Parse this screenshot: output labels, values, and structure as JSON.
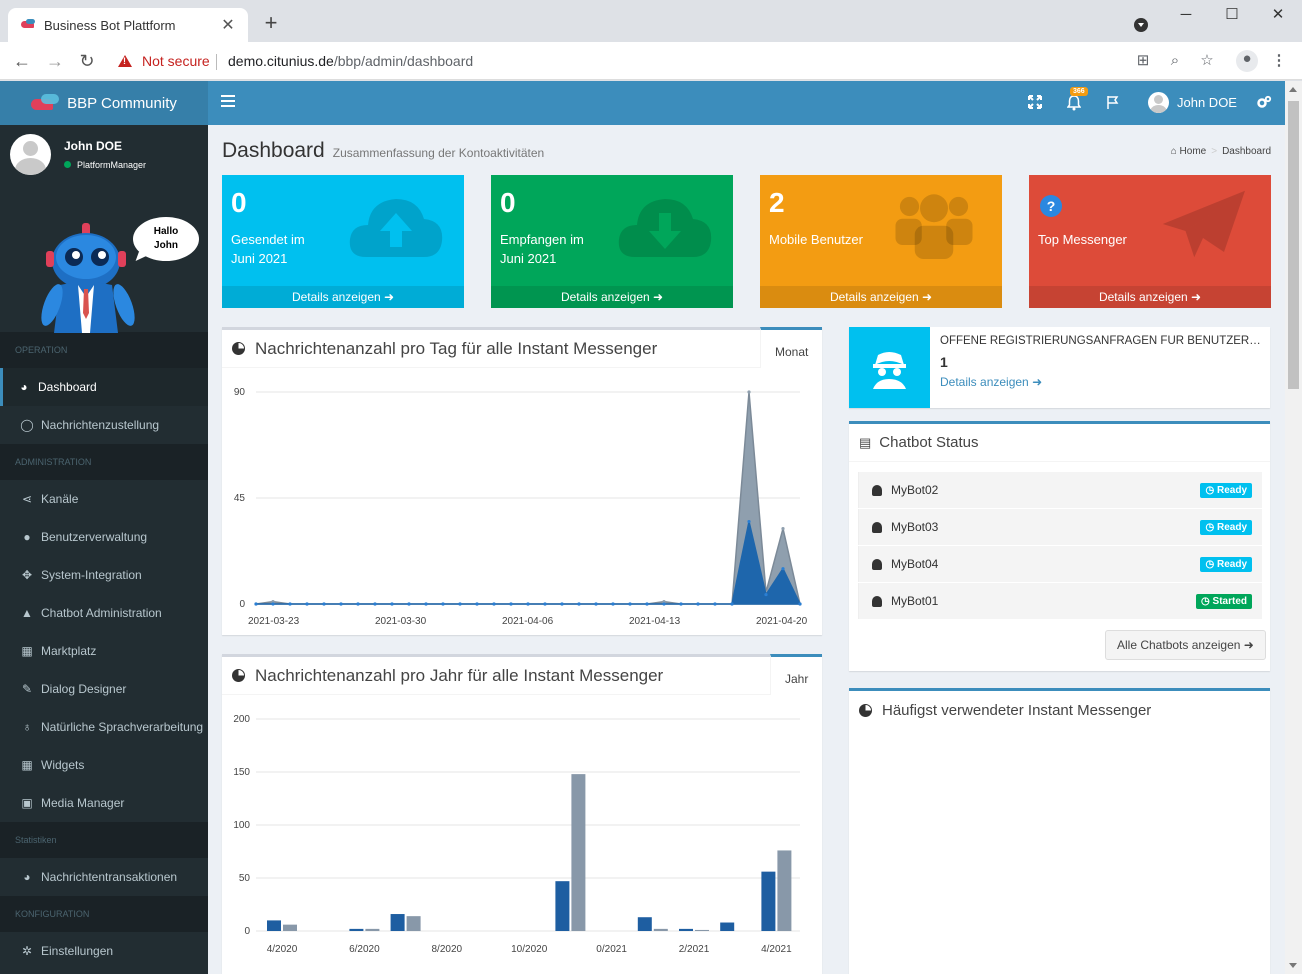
{
  "browser": {
    "tab_title": "Business Bot Plattform",
    "not_secure": "Not secure",
    "url_host": "demo.citunius.de",
    "url_path": "/bbp/admin/dashboard"
  },
  "header": {
    "logo": "BBP Community",
    "notification_count": "366",
    "user_name": "John DOE"
  },
  "sidebar": {
    "user_name": "John DOE",
    "user_role": "PlatformManager",
    "greeting_line1": "Hallo",
    "greeting_line2": "John",
    "sections": {
      "operation": "OPERATION",
      "administration": "ADMINISTRATION",
      "statistiken": "Statistiken",
      "konfiguration": "KONFIGURATION"
    },
    "items": {
      "dashboard": "Dashboard",
      "nachrichtenzustellung": "Nachrichtenzustellung",
      "kanaele": "Kanäle",
      "benutzerverwaltung": "Benutzerverwaltung",
      "system_integration": "System-Integration",
      "chatbot_admin": "Chatbot Administration",
      "marktplatz": "Marktplatz",
      "dialog_designer": "Dialog Designer",
      "nlp": "Natürliche Sprachverarbeitung",
      "widgets": "Widgets",
      "media_manager": "Media Manager",
      "nachrichtentransaktionen": "Nachrichtentransaktionen",
      "einstellungen": "Einstellungen"
    }
  },
  "page": {
    "title": "Dashboard",
    "subtitle": "Zusammenfassung der Kontoaktivitäten",
    "breadcrumb_home": "Home",
    "breadcrumb_current": "Dashboard"
  },
  "stats": [
    {
      "value": "0",
      "label_line1": "Gesendet im",
      "label_line2": "Juni 2021",
      "link": "Details anzeigen",
      "color": "#00c0ef"
    },
    {
      "value": "0",
      "label_line1": "Empfangen im",
      "label_line2": "Juni 2021",
      "link": "Details anzeigen",
      "color": "#00a65a"
    },
    {
      "value": "2",
      "label_line1": "Mobile Benutzer",
      "label_line2": "",
      "link": "Details anzeigen",
      "color": "#f39c12"
    },
    {
      "value": "",
      "label_line1": "Top Messenger",
      "label_line2": "",
      "link": "Details anzeigen",
      "color": "#dd4b39"
    }
  ],
  "daily_chart": {
    "title": "Nachrichtenanzahl pro Tag für alle Instant Messenger",
    "tab": "Monat"
  },
  "yearly_chart": {
    "title": "Nachrichtenanzahl pro Jahr für alle Instant Messenger",
    "tab": "Jahr"
  },
  "registration": {
    "title": "OFFENE REGISTRIERUNGSANFRAGEN FÜR BENUTZERKONTEN",
    "count": "1",
    "link": "Details anzeigen"
  },
  "chatbot_status": {
    "title": "Chatbot Status",
    "bots": [
      {
        "name": "MyBot02",
        "status": "Ready"
      },
      {
        "name": "MyBot03",
        "status": "Ready"
      },
      {
        "name": "MyBot04",
        "status": "Ready"
      },
      {
        "name": "MyBot01",
        "status": "Started"
      }
    ],
    "show_all": "Alle Chatbots anzeigen"
  },
  "messenger_box": {
    "title": "Häufigst verwendeter Instant Messenger"
  },
  "chart_data": [
    {
      "type": "area",
      "ylim": [
        0,
        90
      ],
      "yticks": [
        "0",
        "45",
        "90"
      ],
      "xticks": [
        "2021-03-23",
        "2021-03-30",
        "2021-04-06",
        "2021-04-13",
        "2021-04-20"
      ],
      "series": [
        {
          "values": [
            0,
            1,
            0,
            0,
            0,
            0,
            0,
            0,
            0,
            0,
            0,
            0,
            0,
            0,
            0,
            0,
            0,
            0,
            0,
            0,
            0,
            0,
            0,
            0,
            1,
            0,
            0,
            0,
            0,
            90,
            5,
            32,
            0
          ]
        },
        {
          "values": [
            0,
            0,
            0,
            0,
            0,
            0,
            0,
            0,
            0,
            0,
            0,
            0,
            0,
            0,
            0,
            0,
            0,
            0,
            0,
            0,
            0,
            0,
            0,
            0,
            0,
            0,
            0,
            0,
            0,
            35,
            4,
            15,
            0
          ]
        }
      ]
    },
    {
      "type": "bar",
      "ylim": [
        0,
        200
      ],
      "yticks": [
        "0",
        "50",
        "100",
        "150",
        "200"
      ],
      "xticks": [
        "4/2020",
        "6/2020",
        "8/2020",
        "10/2020",
        "0/2021",
        "2/2021",
        "4/2021"
      ],
      "categories": [
        "4/2020",
        "5/2020",
        "6/2020",
        "7/2020",
        "8/2020",
        "9/2020",
        "10/2020",
        "11/2020",
        "12/2020",
        "1/2021",
        "2/2021",
        "3/2021",
        "4/2021"
      ],
      "series": [
        {
          "values": [
            10,
            0,
            2,
            16,
            0,
            0,
            0,
            47,
            0,
            13,
            2,
            8,
            56
          ]
        },
        {
          "values": [
            6,
            0,
            2,
            14,
            0,
            0,
            0,
            148,
            0,
            2,
            1,
            0,
            76
          ]
        }
      ]
    }
  ]
}
